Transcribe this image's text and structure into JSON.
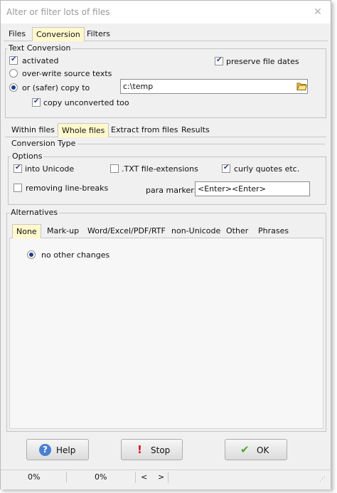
{
  "window": {
    "title": "Alter or filter lots of files"
  },
  "main_tabs": [
    {
      "label": "Files"
    },
    {
      "label": "Conversion",
      "active": true
    },
    {
      "label": "Filters"
    }
  ],
  "text_conversion": {
    "title": "Text Conversion",
    "activated": {
      "label": "activated",
      "checked": true
    },
    "preserve_dates": {
      "label": "preserve file dates",
      "checked": true
    },
    "overwrite": {
      "label": "over-write source texts",
      "selected": false
    },
    "copy_to": {
      "label": "or (safer) copy to",
      "selected": true,
      "path": "c:\\temp"
    },
    "copy_unconverted": {
      "label": "copy unconverted too",
      "checked": true
    }
  },
  "sub_tabs": [
    {
      "label": "Within files"
    },
    {
      "label": "Whole files",
      "active": true
    },
    {
      "label": "Extract from files"
    },
    {
      "label": "Results"
    }
  ],
  "conversion_type": {
    "title": "Conversion Type",
    "options_title": "Options",
    "into_unicode": {
      "label": "into Unicode",
      "checked": true
    },
    "txt_ext": {
      "label": ".TXT file-extensions",
      "checked": false
    },
    "curly_quotes": {
      "label": "curly quotes etc.",
      "checked": true
    },
    "remove_breaks": {
      "label": "removing line-breaks",
      "checked": false
    },
    "para_marker": {
      "label": "para marker:",
      "value": "<Enter><Enter>"
    }
  },
  "alternatives": {
    "title": "Alternatives",
    "tabs": [
      {
        "label": "None",
        "active": true
      },
      {
        "label": "Mark-up"
      },
      {
        "label": "Word/Excel/PDF/RTF"
      },
      {
        "label": "non-Unicode"
      },
      {
        "label": "Other"
      },
      {
        "label": "Phrases"
      }
    ],
    "no_changes": {
      "label": "no other changes",
      "selected": true
    }
  },
  "buttons": {
    "help": "Help",
    "stop": "Stop",
    "ok": "OK"
  },
  "status": {
    "progress1": "0%",
    "progress2": "0%",
    "prev": "<",
    "next": ">"
  },
  "colors": {
    "active_tab": "#fff8cc",
    "accent_blue": "#1f3d8c",
    "stop_red": "#d0101a",
    "ok_green": "#4aa832"
  }
}
